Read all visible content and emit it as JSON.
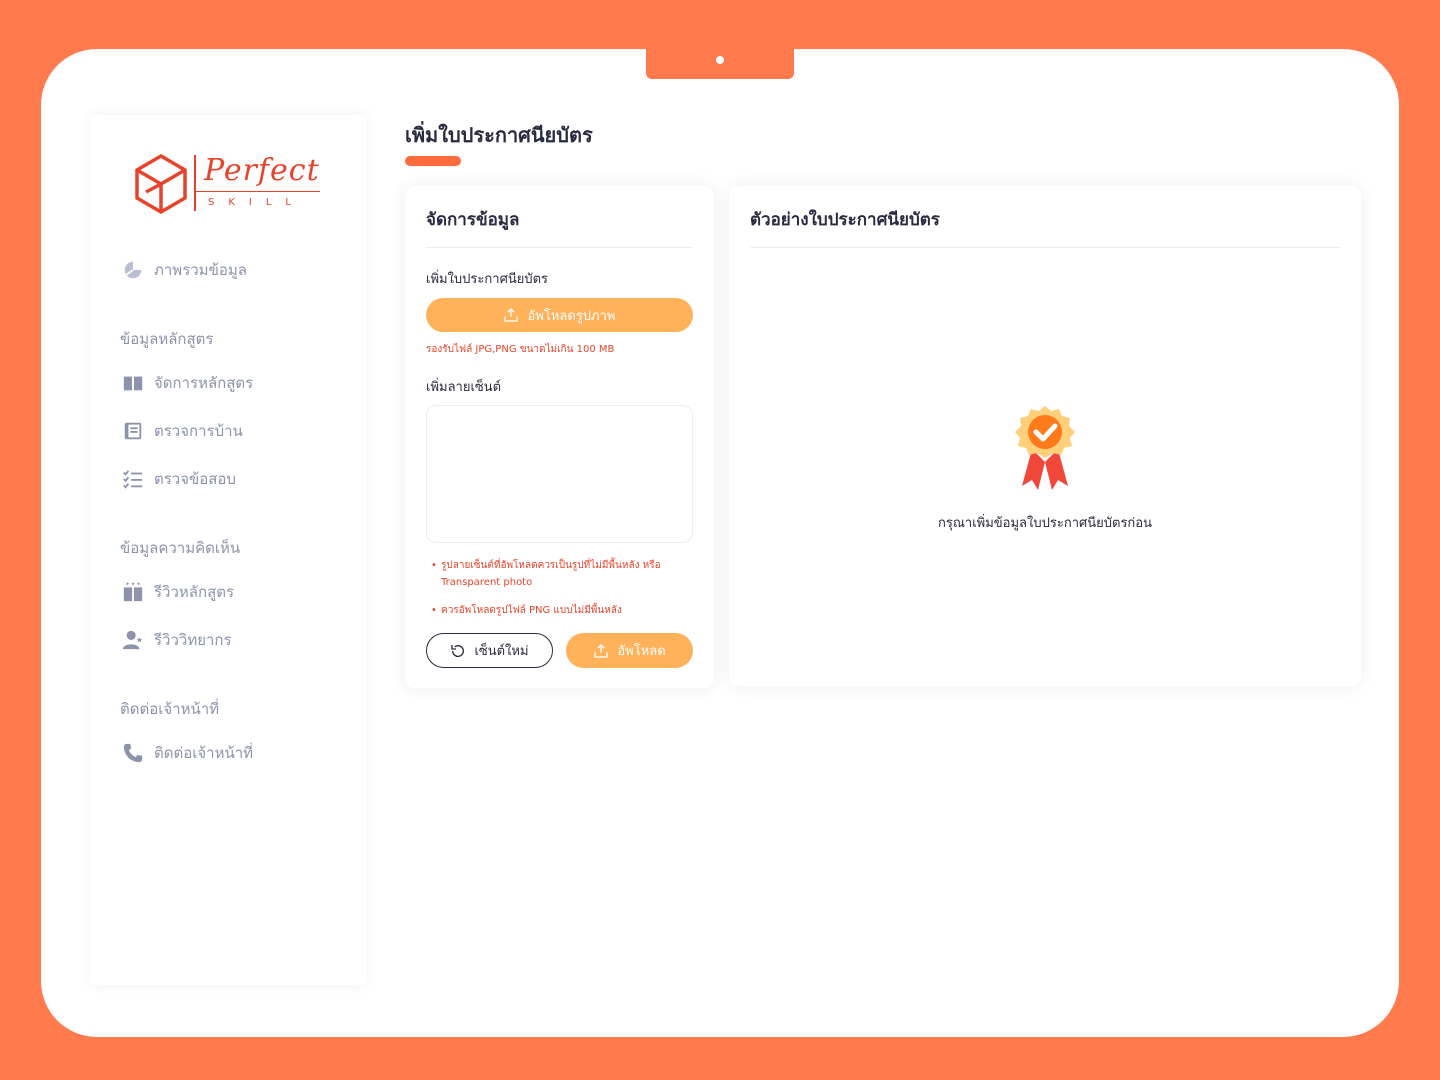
{
  "brand": {
    "name": "Perfect",
    "tagline": "SKILL",
    "color": "#e8432a"
  },
  "sidebar": {
    "overview": {
      "label": "ภาพรวมข้อมูล",
      "icon": "pie-chart-icon"
    },
    "sections": [
      {
        "heading": "ข้อมูลหลักสูตร",
        "items": [
          {
            "label": "จัดการหลักสูตร",
            "icon": "book-icon"
          },
          {
            "label": "ตรวจการบ้าน",
            "icon": "notebook-icon"
          },
          {
            "label": "ตรวจข้อสอบ",
            "icon": "checklist-icon"
          }
        ]
      },
      {
        "heading": "ข้อมูลความคิดเห็น",
        "items": [
          {
            "label": "รีวิวหลักสูตร",
            "icon": "book-review-icon"
          },
          {
            "label": "รีวิววิทยากร",
            "icon": "user-star-icon"
          }
        ]
      },
      {
        "heading": "ติดต่อเจ้าหน้าที่",
        "items": [
          {
            "label": "ติดต่อเจ้าหน้าที่",
            "icon": "phone-icon"
          }
        ]
      }
    ]
  },
  "main": {
    "title": "เพิ่มใบประกาศนียบัตร",
    "accent": "#ff6b3d"
  },
  "form_card": {
    "title": "จัดการข้อมูล",
    "certificate_label": "เพิ่มใบประกาศนียบัตร",
    "upload_image_label": "อัพโหลดรูปภาพ",
    "upload_hint": "รองรับไฟล์ JPG,PNG ขนาดไม่เกิน 100 MB",
    "signature_label": "เพิ่มลายเซ็นต์",
    "signature_value": "",
    "notes": [
      "รูปลายเซ็นต์ที่อัพโหลดควรเป็นรูปที่ไม่มีพื้นหลัง หรือ Transparent photo",
      "ควรอัพโหลดรูปไฟล์ PNG แบบไม่มีพื้นหลัง"
    ],
    "reset_label": "เซ็นต์ใหม่",
    "submit_label": "อัพโหลด",
    "button_color": "#ffb25a"
  },
  "preview_card": {
    "title": "ตัวอย่างใบประกาศนียบัตร",
    "empty_message": "กรุณาเพิ่มข้อมูลใบประกาศนียบัตรก่อน",
    "icon": "award-badge-icon"
  }
}
